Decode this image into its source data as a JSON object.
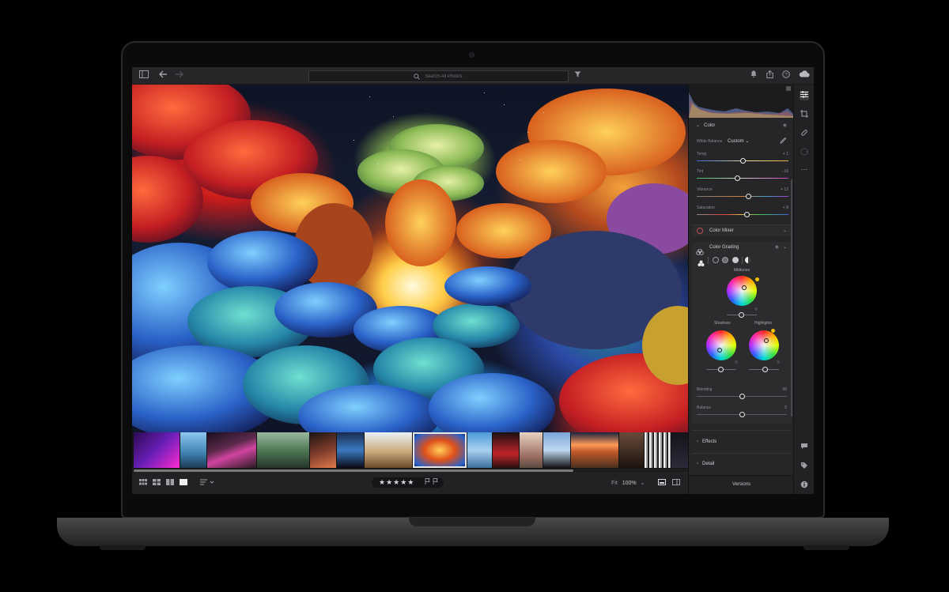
{
  "topbar": {
    "search_placeholder": "Search All Photos"
  },
  "panel": {
    "color_section": "Color",
    "white_balance_label": "White Balance",
    "white_balance_value": "Custom",
    "sliders": [
      {
        "label": "Temp",
        "value": "+ 1",
        "position": 0.5
      },
      {
        "label": "Tint",
        "value": "- 16",
        "position": 0.44
      },
      {
        "label": "Vibrance",
        "value": "+ 12",
        "position": 0.56
      },
      {
        "label": "Saturation",
        "value": "+ 8",
        "position": 0.54
      }
    ],
    "color_mixer": "Color Mixer",
    "color_grading": "Color Grading",
    "midtones": "Midtones",
    "shadows": "Shadows",
    "highlights": "Highlights",
    "blending_label": "Blending",
    "blending_value": "50",
    "blending_position": 0.5,
    "balance_label": "Balance",
    "balance_value": "0",
    "balance_position": 0.5,
    "effects": "Effects",
    "detail": "Detail",
    "versions": "Versions"
  },
  "bottombar": {
    "rating": "★★★★★",
    "zoom_label": "Fit",
    "zoom_value": "100%"
  },
  "icons": {
    "back": "arrow-left-icon",
    "forward": "arrow-right-icon",
    "filter": "filter-icon",
    "bell": "bell-icon",
    "share": "share-icon",
    "help": "help-icon",
    "cloud": "cloud-icon"
  },
  "colors": {
    "panel_bg": "#262628",
    "accent_wheel": "#f2c200"
  }
}
